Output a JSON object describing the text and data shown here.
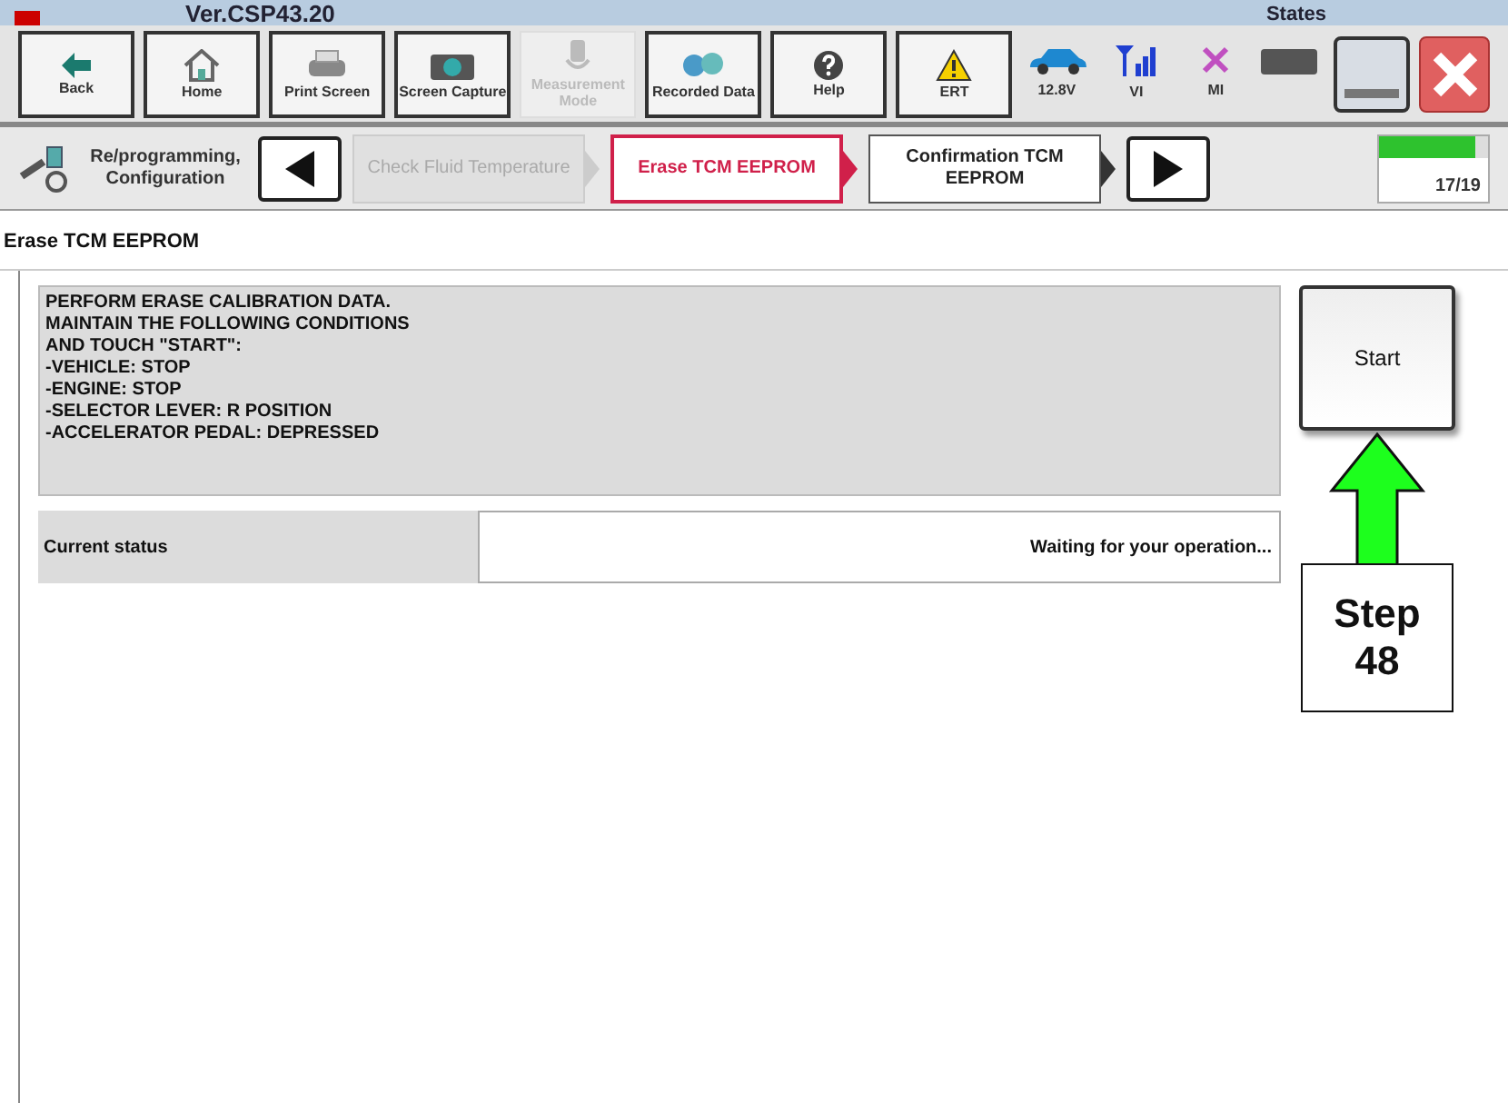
{
  "header": {
    "version": "Ver.CSP43.20",
    "states_label": "States"
  },
  "toolbar": [
    {
      "label": "Back",
      "kind": "back",
      "disabled": false
    },
    {
      "label": "Home",
      "kind": "home",
      "disabled": false
    },
    {
      "label": "Print Screen",
      "kind": "print",
      "disabled": false
    },
    {
      "label": "Screen Capture",
      "kind": "camera",
      "disabled": false
    },
    {
      "label": "Measurement Mode",
      "kind": "measure",
      "disabled": true
    },
    {
      "label": "Recorded Data",
      "kind": "data",
      "disabled": false
    },
    {
      "label": "Help",
      "kind": "help",
      "disabled": false
    },
    {
      "label": "ERT",
      "kind": "warning",
      "disabled": false
    }
  ],
  "status": [
    {
      "label": "12.8V",
      "kind": "car"
    },
    {
      "label": "VI",
      "kind": "signal"
    },
    {
      "label": "MI",
      "kind": "cross"
    }
  ],
  "breadcrumb": {
    "section": "Re/programming, Configuration",
    "steps": [
      {
        "label": "Check Fluid Temperature",
        "disabled": true,
        "selected": false
      },
      {
        "label": "Erase TCM EEPROM",
        "disabled": false,
        "selected": true
      },
      {
        "label": "Confirmation TCM EEPROM",
        "disabled": false,
        "selected": false
      }
    ],
    "progress": {
      "label": "17/19",
      "level": 0.89
    }
  },
  "page_title": "Erase TCM EEPROM",
  "instructions": [
    "PERFORM ERASE CALIBRATION DATA.",
    "MAINTAIN THE FOLLOWING CONDITIONS",
    "AND TOUCH \"START\":",
    "-VEHICLE: STOP",
    "-ENGINE: STOP",
    "-SELECTOR LEVER: R POSITION",
    "-ACCELERATOR PEDAL: DEPRESSED"
  ],
  "start_button": "Start",
  "status_row": {
    "label": "Current status",
    "value": "Waiting for your operation..."
  },
  "callout": {
    "label": "Step 48"
  }
}
